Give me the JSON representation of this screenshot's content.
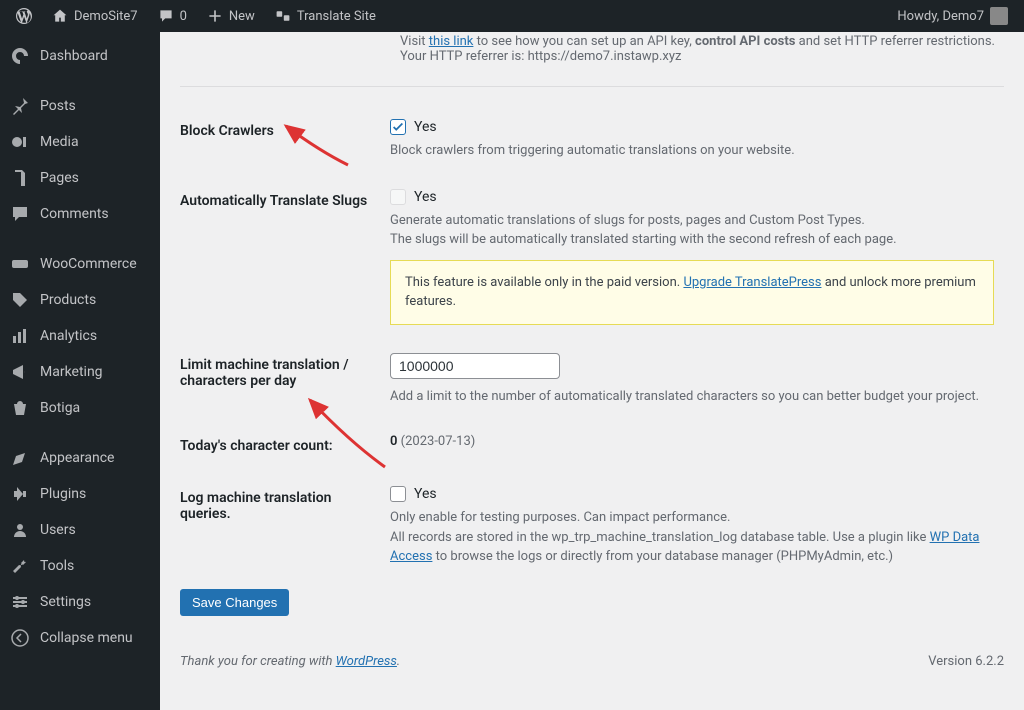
{
  "adminbar": {
    "site_name": "DemoSite7",
    "comments_count": "0",
    "new_label": "New",
    "translate_label": "Translate Site",
    "howdy": "Howdy, Demo7"
  },
  "sidebar": {
    "dashboard": "Dashboard",
    "posts": "Posts",
    "media": "Media",
    "pages": "Pages",
    "comments": "Comments",
    "woocommerce": "WooCommerce",
    "products": "Products",
    "analytics": "Analytics",
    "marketing": "Marketing",
    "botiga": "Botiga",
    "appearance": "Appearance",
    "plugins": "Plugins",
    "users": "Users",
    "tools": "Tools",
    "settings": "Settings",
    "collapse": "Collapse menu"
  },
  "truncated": {
    "prefix": "Visit ",
    "link": "this link",
    "mid": " to see how you can set up an API key, ",
    "bold": "control API costs",
    "after": " and set HTTP referrer restrictions.",
    "referrer_label": "Your HTTP referrer is: ",
    "referrer_value": "https://demo7.instawp.xyz"
  },
  "rows": {
    "block_crawlers": {
      "label": "Block Crawlers",
      "checkbox_label": "Yes",
      "checked": true,
      "desc": "Block crawlers from triggering automatic translations on your website."
    },
    "auto_slugs": {
      "label": "Automatically Translate Slugs",
      "checkbox_label": "Yes",
      "checked": false,
      "desc1": "Generate automatic translations of slugs for posts, pages and Custom Post Types.",
      "desc2": "The slugs will be automatically translated starting with the second refresh of each page.",
      "notice_before": "This feature is available only in the paid version. ",
      "notice_link": "Upgrade TranslatePress",
      "notice_after": " and unlock more premium features."
    },
    "limit": {
      "label": "Limit machine translation / characters per day",
      "value": "1000000",
      "desc": "Add a limit to the number of automatically translated characters so you can better budget your project."
    },
    "today_count": {
      "label": "Today's character count:",
      "value": "0",
      "date": " (2023-07-13)"
    },
    "log_queries": {
      "label": "Log machine translation queries.",
      "checkbox_label": "Yes",
      "checked": false,
      "desc1": "Only enable for testing purposes. Can impact performance.",
      "desc2_before": "All records are stored in the wp_trp_machine_translation_log database table. Use a plugin like ",
      "desc2_link": "WP Data Access",
      "desc2_after": " to browse the logs or directly from your database manager (PHPMyAdmin, etc.)"
    }
  },
  "save_button": "Save Changes",
  "footer": {
    "thanks_before": "Thank you for creating with ",
    "thanks_link": "WordPress",
    "thanks_after": ".",
    "version": "Version 6.2.2"
  }
}
